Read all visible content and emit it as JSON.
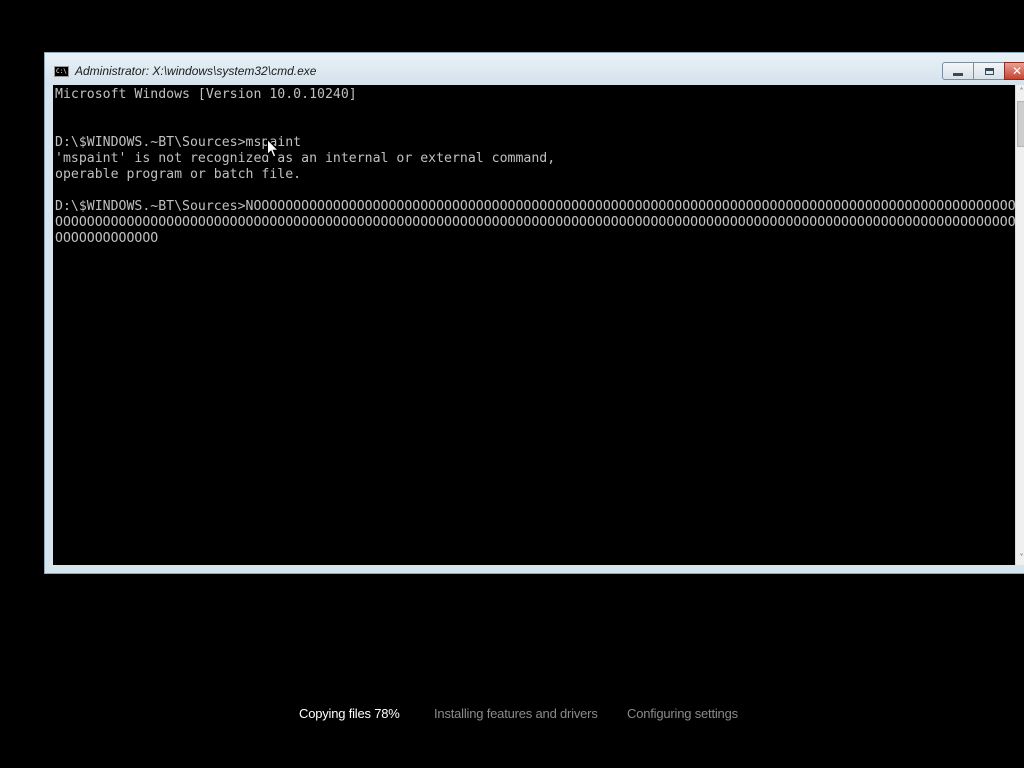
{
  "window": {
    "title": "Administrator: X:\\windows\\system32\\cmd.exe",
    "icon_label": "C:\\",
    "icon": "console-icon",
    "buttons": {
      "minimize_icon": "minimize-icon",
      "maximize_icon": "maximize-icon",
      "close_icon": "close-icon",
      "close_glyph": "✕"
    }
  },
  "console": {
    "lines": [
      "Microsoft Windows [Version 10.0.10240]",
      "",
      "",
      "D:\\$WINDOWS.~BT\\Sources>mspaint",
      "'mspaint' is not recognized as an internal or external command,",
      "operable program or batch file.",
      "",
      "D:\\$WINDOWS.~BT\\Sources>NOOOOOOOOOOOOOOOOOOOOOOOOOOOOOOOOOOOOOOOOOOOOOOOOOOOOOOOOOOOOOOOOOOOOOOOOOOOOOOOOOOOOOOOOOOOOOOOOOOOOOOOOOOOOO",
      "OOOOOOOOOOOOOOOOOOOOOOOOOOOOOOOOOOOOOOOOOOOOOOOOOOOOOOOOOOOOOOOOOOOOOOOOOOOOOOOOOOOOOOOOOOOOOOOOOOOOOOOOOOOOOOOOOOOOOOOOOOOOOO",
      "OOOOOOOOOOOOO"
    ],
    "background": "#000000",
    "foreground": "#c0c0c0"
  },
  "scrollbar": {
    "up_arrow": "˄",
    "down_arrow": "˅"
  },
  "setup_steps": [
    {
      "label": "Copying files 78%",
      "state": "active"
    },
    {
      "label": "Installing features and drivers",
      "state": "inactive"
    },
    {
      "label": "Configuring settings",
      "state": "inactive"
    }
  ],
  "colors": {
    "desktop": "#000000",
    "window_frame": "#d6e4ee",
    "close_button": "#c74432",
    "step_active": "#ffffff",
    "step_inactive": "#8a8a8a"
  }
}
